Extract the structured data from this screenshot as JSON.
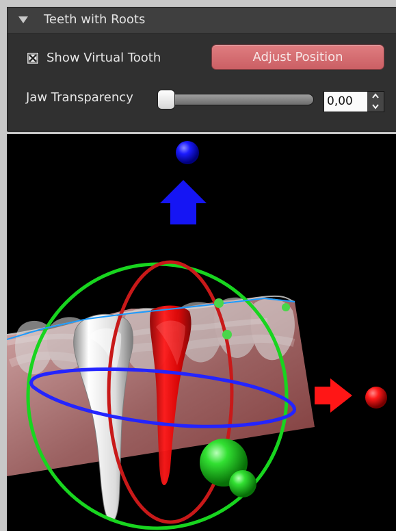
{
  "panel": {
    "title": "Teeth with Roots",
    "show_virtual_tooth_label": "Show Virtual Tooth",
    "show_virtual_tooth_checked": true,
    "adjust_position_label": "Adjust Position",
    "jaw_transparency_label": "Jaw Transparency",
    "jaw_transparency_value": "0,00",
    "jaw_transparency_level": 0
  },
  "icons": {
    "collapse": "triangle-down-icon",
    "checkbox_mark": "x-mark-icon",
    "spin_up": "chevron-up-icon",
    "spin_down": "chevron-down-icon"
  },
  "colors": {
    "panel_bg": "#343434",
    "header_bg": "#3f3f3f",
    "button_red": "#d86e72",
    "viewport_bg": "#000000",
    "gizmo_green": "#22d42c",
    "gizmo_red": "#e11111",
    "gizmo_blue": "#2020ff"
  }
}
